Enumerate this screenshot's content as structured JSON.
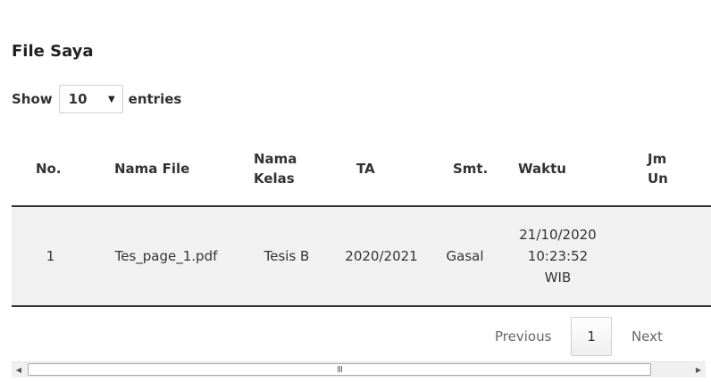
{
  "panel": {
    "title": "File Saya"
  },
  "length": {
    "show_label": "Show",
    "selected": "10",
    "entries_label": "entries"
  },
  "table": {
    "columns": [
      "No.",
      "Nama File",
      "Nama\nKelas",
      "TA",
      "Smt.",
      "Waktu",
      "Jm\nUn"
    ],
    "rows": [
      {
        "no": "1",
        "nama_file": "Tes_page_1.pdf",
        "nama_kelas": "Tesis B",
        "ta": "2020/2021",
        "smt": "Gasal",
        "waktu": "21/10/2020\n10:23:52\nWIB",
        "jml": ""
      }
    ]
  },
  "pagination": {
    "previous": "Previous",
    "current": "1",
    "next": "Next"
  },
  "scrollbar": {
    "left_arrow": "◀",
    "right_arrow": "▶",
    "grip": "III"
  }
}
